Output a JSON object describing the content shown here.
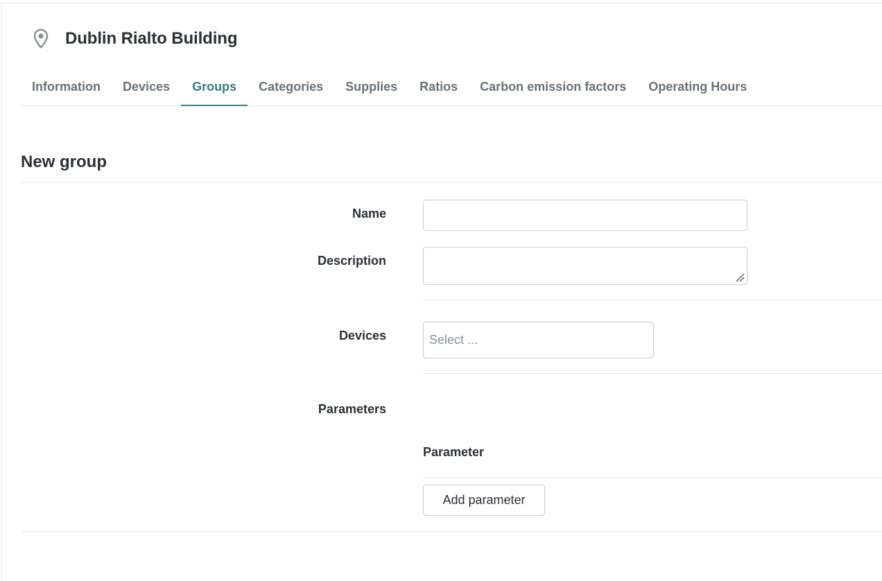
{
  "header": {
    "icon": "map-pin-icon",
    "title": "Dublin Rialto Building"
  },
  "tabs": [
    {
      "label": "Information",
      "active": false
    },
    {
      "label": "Devices",
      "active": false
    },
    {
      "label": "Groups",
      "active": true
    },
    {
      "label": "Categories",
      "active": false
    },
    {
      "label": "Supplies",
      "active": false
    },
    {
      "label": "Ratios",
      "active": false
    },
    {
      "label": "Carbon emission factors",
      "active": false
    },
    {
      "label": "Operating Hours",
      "active": false
    }
  ],
  "form": {
    "title": "New group",
    "name": {
      "label": "Name",
      "value": ""
    },
    "description": {
      "label": "Description",
      "value": ""
    },
    "devices": {
      "label": "Devices",
      "placeholder": "Select ..."
    },
    "parameters": {
      "label": "Parameters",
      "column_header": "Parameter",
      "add_button": "Add parameter"
    }
  },
  "colors": {
    "accent": "#3a7d80",
    "tab_inactive": "#6c7075",
    "text": "#2d2f33",
    "border": "#c9cccf"
  }
}
